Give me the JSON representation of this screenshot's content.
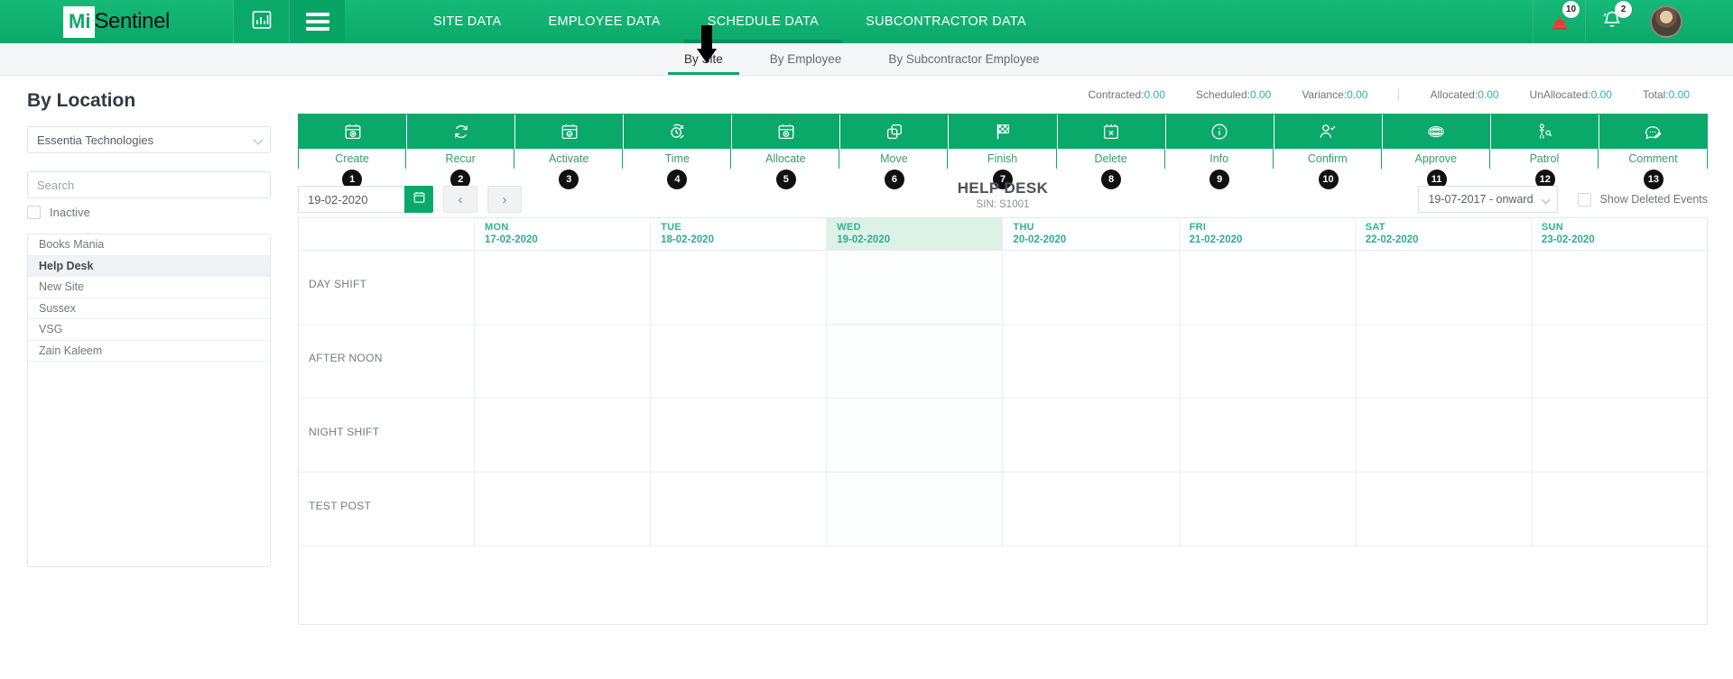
{
  "brand": {
    "mi": "Mi",
    "rest": "Sentinel"
  },
  "topnav": {
    "items": [
      {
        "label": "SITE DATA",
        "active": false
      },
      {
        "label": "EMPLOYEE DATA",
        "active": false
      },
      {
        "label": "SCHEDULE DATA",
        "active": true
      },
      {
        "label": "SUBCONTRACTOR DATA",
        "active": false
      }
    ],
    "alert_badge": "10",
    "bell_badge": "2"
  },
  "subnav": {
    "items": [
      {
        "label": "By Site",
        "active": true
      },
      {
        "label": "By Employee",
        "active": false
      },
      {
        "label": "By Subcontractor Employee",
        "active": false
      }
    ]
  },
  "sidebar": {
    "title": "By Location",
    "company_select": "Essentia Technologies",
    "search_placeholder": "Search",
    "inactive_label": "Inactive",
    "sites": [
      {
        "label": "Books Mania",
        "selected": false
      },
      {
        "label": "Help Desk",
        "selected": true
      },
      {
        "label": "New Site",
        "selected": false
      },
      {
        "label": "Sussex",
        "selected": false
      },
      {
        "label": "VSG",
        "selected": false
      },
      {
        "label": "Zain Kaleem",
        "selected": false
      }
    ]
  },
  "stats": [
    {
      "label": "Contracted:",
      "value": "0.00",
      "divide": false
    },
    {
      "label": "Scheduled:",
      "value": "0.00",
      "divide": false
    },
    {
      "label": "Variance:",
      "value": "0.00",
      "divide": false
    },
    {
      "label": "Allocated:",
      "value": "0.00",
      "divide": true
    },
    {
      "label": "UnAllocated:",
      "value": "0.00",
      "divide": false
    },
    {
      "label": "Total:",
      "value": "0.00",
      "divide": false
    }
  ],
  "toolbar": [
    {
      "label": "Create",
      "num": "1",
      "icon": "calendar-plus-icon"
    },
    {
      "label": "Recur",
      "num": "2",
      "icon": "repeat-icon"
    },
    {
      "label": "Activate",
      "num": "3",
      "icon": "calendar-check-icon"
    },
    {
      "label": "Time",
      "num": "4",
      "icon": "clock-repeat-icon"
    },
    {
      "label": "Allocate",
      "num": "5",
      "icon": "calendar-allocate-icon"
    },
    {
      "label": "Move",
      "num": "6",
      "icon": "copy-move-icon"
    },
    {
      "label": "Finish",
      "num": "7",
      "icon": "checkered-flag-icon"
    },
    {
      "label": "Delete",
      "num": "8",
      "icon": "calendar-x-icon"
    },
    {
      "label": "Info",
      "num": "9",
      "icon": "info-circle-icon"
    },
    {
      "label": "Confirm",
      "num": "10",
      "icon": "user-check-icon"
    },
    {
      "label": "Approve",
      "num": "11",
      "icon": "approve-stamp-icon"
    },
    {
      "label": "Patrol",
      "num": "12",
      "icon": "patrol-guard-icon"
    },
    {
      "label": "Comment",
      "num": "13",
      "icon": "comment-edit-icon"
    }
  ],
  "controls": {
    "date_value": "19-02-2020",
    "prev_label": "‹",
    "next_label": "›",
    "site_name": "HELP DESK",
    "site_sin": "SIN: S1001",
    "range_value": "19-07-2017 - onward",
    "show_deleted_label": "Show Deleted Events"
  },
  "calendar": {
    "days": [
      {
        "dow": "MON",
        "date": "17-02-2020",
        "today": false
      },
      {
        "dow": "TUE",
        "date": "18-02-2020",
        "today": false
      },
      {
        "dow": "WED",
        "date": "19-02-2020",
        "today": true
      },
      {
        "dow": "THU",
        "date": "20-02-2020",
        "today": false
      },
      {
        "dow": "FRI",
        "date": "21-02-2020",
        "today": false
      },
      {
        "dow": "SAT",
        "date": "22-02-2020",
        "today": false
      },
      {
        "dow": "SUN",
        "date": "23-02-2020",
        "today": false
      }
    ],
    "rows": [
      {
        "label": "DAY SHIFT"
      },
      {
        "label": "AFTER NOON"
      },
      {
        "label": "NIGHT SHIFT"
      },
      {
        "label": "TEST POST"
      }
    ]
  },
  "colors": {
    "brand_green": "#0aa869",
    "teal": "#2fae8c",
    "badge_black": "#111111"
  }
}
